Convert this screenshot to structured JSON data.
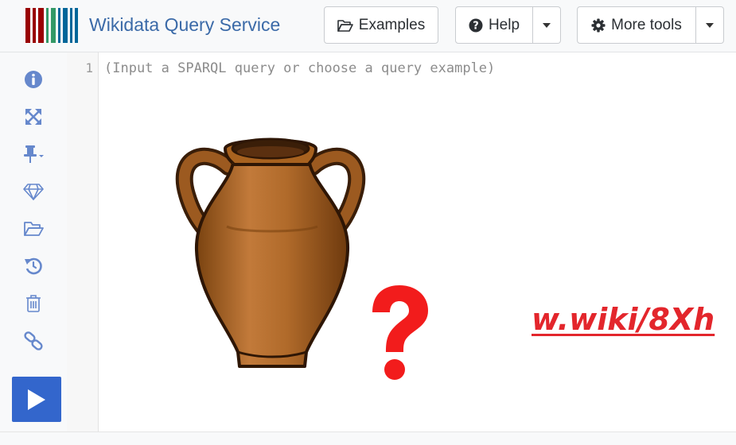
{
  "app": {
    "title": "Wikidata Query Service",
    "logo_colors": [
      "#990000",
      "#339966",
      "#006699"
    ]
  },
  "header": {
    "examples_label": "Examples",
    "help_label": "Help",
    "more_tools_label": "More tools"
  },
  "toolbar": {
    "items": [
      {
        "icon": "info-icon"
      },
      {
        "icon": "fullscreen-icon"
      },
      {
        "icon": "pin-icon"
      },
      {
        "icon": "diamond-icon"
      },
      {
        "icon": "folder-open-icon"
      },
      {
        "icon": "history-icon"
      },
      {
        "icon": "trash-icon"
      },
      {
        "icon": "link-icon"
      }
    ],
    "run_icon": "play-icon",
    "accent_color": "#3366cc",
    "icon_color": "#6688cc"
  },
  "editor": {
    "line_number": "1",
    "placeholder": "(Input a SPARQL query or choose a query example)"
  },
  "overlay": {
    "vase_icon": "amphora-vase",
    "question_icon": "question-mark",
    "link_text": "w.wiki/8Xh",
    "link_color": "#e3262c"
  }
}
